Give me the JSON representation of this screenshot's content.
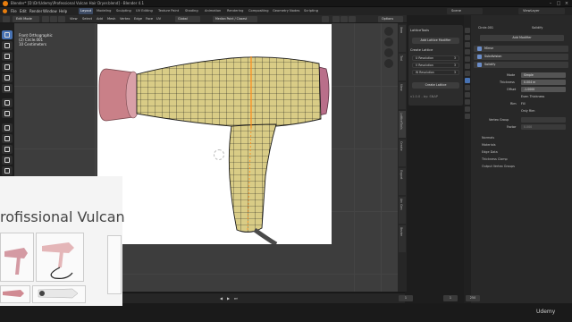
{
  "window": {
    "title": "Blender* [D:\\Dr\\Udemy\\Professional Vulcan Hair Dryer.blend] - Blender 4.1",
    "controls": [
      "minimize",
      "maximize",
      "close"
    ]
  },
  "menubar": {
    "items": [
      "File",
      "Edit",
      "Render",
      "Window",
      "Help"
    ],
    "workspaces": [
      "Layout",
      "Modeling",
      "Sculpting",
      "UV Editing",
      "Texture Paint",
      "Shading",
      "Animation",
      "Rendering",
      "Compositing",
      "Geometry Nodes",
      "Scripting"
    ],
    "active_workspace": "Layout",
    "scene": "Scene",
    "view_layer": "ViewLayer"
  },
  "viewport_header": {
    "mode": "Edit Mode",
    "items": [
      "View",
      "Select",
      "Add",
      "Mesh",
      "Vertex",
      "Edge",
      "Face",
      "UV"
    ],
    "transform": "Global",
    "snapping": "Median Point / Closest",
    "shading": "Options"
  },
  "viewport": {
    "info_line1": "Front Orthographic",
    "info_line2": "(2) Circle.001",
    "info_line3": "10 Centimeters"
  },
  "toolbar": {
    "tools": [
      "select-box-icon",
      "cursor-icon",
      "move-icon",
      "rotate-icon",
      "scale-icon",
      "transform-icon",
      "annotate-icon",
      "measure-icon",
      "add-cube-icon",
      "extrude-icon",
      "inset-icon",
      "bevel-icon",
      "loop-cut-icon",
      "knife-icon",
      "poly-build-icon",
      "spin-icon",
      "smooth-icon",
      "edge-slide-icon",
      "shrink-icon",
      "shear-icon",
      "rip-icon"
    ]
  },
  "lattice_panel": {
    "header": "LatticeTools",
    "add_button": "Add Lattice Modifier",
    "create_header": "Create Lattice",
    "resolutions": [
      {
        "label": "U Resolution",
        "value": "3"
      },
      {
        "label": "V Resolution",
        "value": "3"
      },
      {
        "label": "W Resolution",
        "value": "3"
      }
    ],
    "create_button": "Create Lattice",
    "version": "v1.0.0 - by: SNAP"
  },
  "n_panel_tabs": [
    "Item",
    "Tool",
    "View",
    "Edit",
    "LatticeTools",
    "Create",
    "Export",
    "Arc Gen",
    "Bezier",
    "BlenderKit"
  ],
  "properties": {
    "object_name": "Circle.001",
    "modifier_tab": "Solidify",
    "add_modifier": "Add Modifier",
    "modifiers": [
      "Mirror",
      "Subdivision",
      "Solidify"
    ],
    "solidify": {
      "mode_label": "Mode",
      "mode_value": "Simple",
      "thickness_label": "Thickness",
      "thickness_value": "0.004 m",
      "offset_label": "Offset",
      "offset_value": "-1.0000",
      "even_thickness": "Even Thickness",
      "rim_label": "Rim",
      "rim_fill": "Fill",
      "only_rim": "Only Rim",
      "vertex_group_label": "Vertex Group",
      "factor_label": "Factor",
      "factor_value": "0.000"
    },
    "subpanels": [
      "Normals",
      "Materials",
      "Edge Data",
      "Thickness Clamp",
      "Output Vertex Groups"
    ]
  },
  "timeline": {
    "frame_current": "1",
    "start": "1",
    "end": "250"
  },
  "overlay_video": {
    "title": "rofissional Vulcan",
    "watermark": "Udemy"
  },
  "colors": {
    "mesh_fill": "#d9cc86",
    "mesh_edge": "#1a1a1a",
    "dryer_rose": "#c87f88",
    "seam": "#ff8c1a",
    "accent": "#4772b3"
  }
}
